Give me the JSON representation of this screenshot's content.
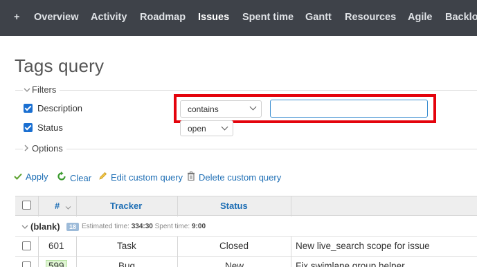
{
  "nav": {
    "items": [
      "+",
      "Overview",
      "Activity",
      "Roadmap",
      "Issues",
      "Spent time",
      "Gantt",
      "Resources",
      "Agile",
      "Backlog"
    ],
    "selected": "Issues"
  },
  "page": {
    "title": "Tags query"
  },
  "filters": {
    "legend": "Filters",
    "description": {
      "label": "Description",
      "operator": "contains",
      "value": ""
    },
    "status": {
      "label": "Status",
      "operator": "open"
    }
  },
  "options": {
    "legend": "Options"
  },
  "actions": {
    "apply": "Apply",
    "clear": "Clear",
    "edit": "Edit custom query",
    "delete": "Delete custom query"
  },
  "table": {
    "headers": {
      "id": "#",
      "tracker": "Tracker",
      "status": "Status"
    },
    "group": {
      "title": "(blank)",
      "count": "18",
      "est_label": "Estimated time:",
      "est_value": "334:30",
      "spent_label": "Spent time:",
      "spent_value": "9:00"
    },
    "rows": [
      {
        "id": "601",
        "tracker": "Task",
        "status": "Closed",
        "subject": "New live_search scope for issue"
      },
      {
        "id": "599",
        "tracker": "Bug",
        "status": "New",
        "subject": "Fix swimlane group helper"
      }
    ]
  },
  "colors": {
    "nav_bg": "#3e4249",
    "link": "#1f6fb5",
    "highlight": "#e4030c",
    "checkbox": "#1a6fd1"
  }
}
